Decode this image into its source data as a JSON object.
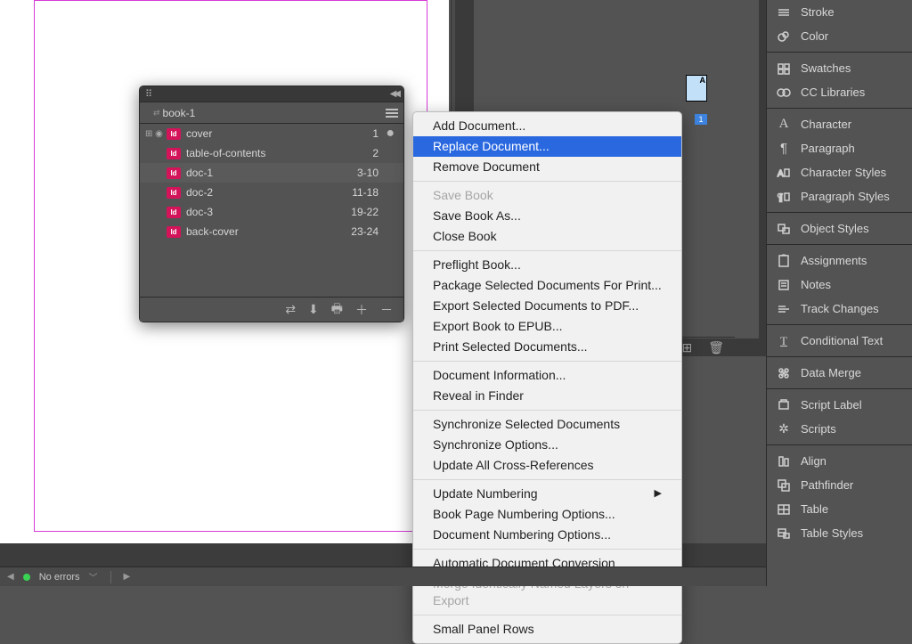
{
  "bookPanel": {
    "tabName": "book-1",
    "rows": [
      {
        "name": "cover",
        "pages": "1",
        "modified": true,
        "leading": true
      },
      {
        "name": "table-of-contents",
        "pages": "2",
        "modified": false,
        "leading": false
      },
      {
        "name": "doc-1",
        "pages": "3-10",
        "modified": false,
        "leading": false,
        "selected": true
      },
      {
        "name": "doc-2",
        "pages": "11-18",
        "modified": false,
        "leading": false
      },
      {
        "name": "doc-3",
        "pages": "19-22",
        "modified": false,
        "leading": false
      },
      {
        "name": "back-cover",
        "pages": "23-24",
        "modified": false,
        "leading": false
      }
    ],
    "footerIcons": [
      "sync",
      "save",
      "print",
      "add",
      "remove"
    ]
  },
  "contextMenu": {
    "groups": [
      [
        {
          "label": "Add Document..."
        },
        {
          "label": "Replace Document...",
          "highlight": true
        },
        {
          "label": "Remove Document"
        }
      ],
      [
        {
          "label": "Save Book",
          "disabled": true
        },
        {
          "label": "Save Book As..."
        },
        {
          "label": "Close Book"
        }
      ],
      [
        {
          "label": "Preflight Book..."
        },
        {
          "label": "Package Selected Documents For Print..."
        },
        {
          "label": "Export Selected Documents to PDF..."
        },
        {
          "label": "Export Book to EPUB..."
        },
        {
          "label": "Print Selected Documents..."
        }
      ],
      [
        {
          "label": "Document Information..."
        },
        {
          "label": "Reveal in Finder"
        }
      ],
      [
        {
          "label": "Synchronize Selected Documents"
        },
        {
          "label": "Synchronize Options..."
        },
        {
          "label": "Update All Cross-References"
        }
      ],
      [
        {
          "label": "Update Numbering",
          "submenu": true
        },
        {
          "label": "Book Page Numbering Options..."
        },
        {
          "label": "Document Numbering Options..."
        }
      ],
      [
        {
          "label": "Automatic Document Conversion"
        },
        {
          "label": "Merge Identically Named Layers on Export",
          "disabled": true
        }
      ],
      [
        {
          "label": "Small Panel Rows"
        }
      ]
    ]
  },
  "pagesPanel": {
    "masterBadge": "A",
    "pageBadge": "1"
  },
  "sidePanels": [
    [
      {
        "name": "Stroke",
        "icon": "stroke"
      },
      {
        "name": "Color",
        "icon": "color"
      }
    ],
    [
      {
        "name": "Swatches",
        "icon": "swatches"
      },
      {
        "name": "CC Libraries",
        "icon": "cc"
      }
    ],
    [
      {
        "name": "Character",
        "icon": "character"
      },
      {
        "name": "Paragraph",
        "icon": "paragraph"
      },
      {
        "name": "Character Styles",
        "icon": "charstyles"
      },
      {
        "name": "Paragraph Styles",
        "icon": "parastyles"
      }
    ],
    [
      {
        "name": "Object Styles",
        "icon": "objstyles"
      }
    ],
    [
      {
        "name": "Assignments",
        "icon": "assignments"
      },
      {
        "name": "Notes",
        "icon": "notes"
      },
      {
        "name": "Track Changes",
        "icon": "track"
      }
    ],
    [
      {
        "name": "Conditional Text",
        "icon": "conditional"
      }
    ],
    [
      {
        "name": "Data Merge",
        "icon": "datamerge"
      }
    ],
    [
      {
        "name": "Script Label",
        "icon": "scriptlabel"
      },
      {
        "name": "Scripts",
        "icon": "scripts"
      }
    ],
    [
      {
        "name": "Align",
        "icon": "align"
      },
      {
        "name": "Pathfinder",
        "icon": "pathfinder"
      },
      {
        "name": "Table",
        "icon": "table"
      },
      {
        "name": "Table Styles",
        "icon": "tablestyles"
      }
    ]
  ],
  "statusBar": {
    "preflight": "No errors"
  }
}
